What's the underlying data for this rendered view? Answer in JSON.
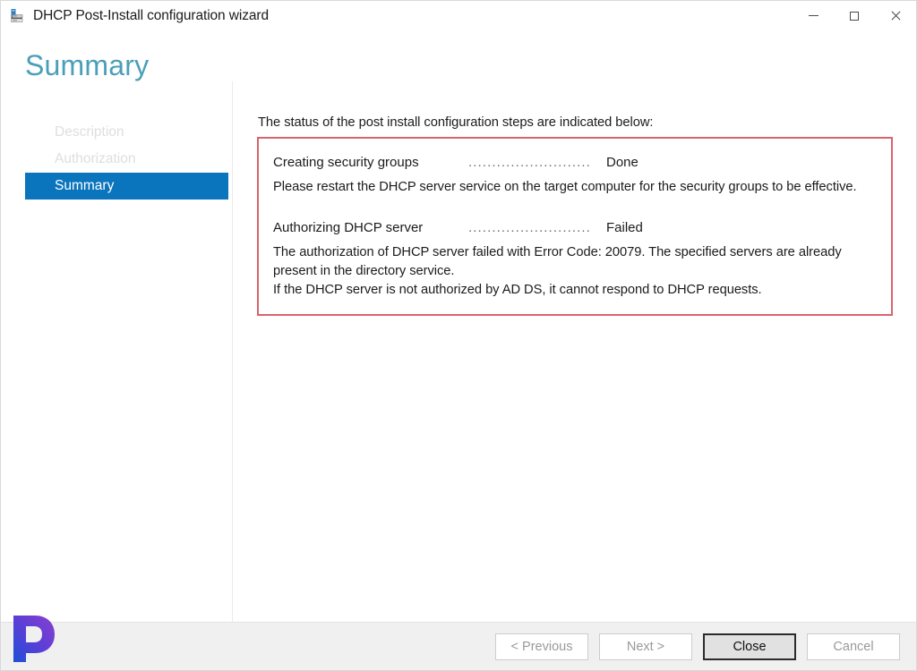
{
  "window": {
    "title": "DHCP Post-Install configuration wizard",
    "icon": "dhcp-server-icon",
    "controls": {
      "minimize": "minimize-icon",
      "maximize": "maximize-icon",
      "close": "close-icon"
    }
  },
  "page": {
    "heading": "Summary",
    "heading_color": "#4a9fb8"
  },
  "sidebar": {
    "items": [
      {
        "label": "Description",
        "state": "disabled"
      },
      {
        "label": "Authorization",
        "state": "disabled"
      },
      {
        "label": "Summary",
        "state": "selected"
      }
    ],
    "selected_color": "#0a74bd"
  },
  "main": {
    "intro": "The status of the post install configuration steps are indicated below:",
    "panel": {
      "border_color": "#d9636d",
      "rows": [
        {
          "label": "Creating security groups",
          "leader": "......................................",
          "value": "Done",
          "note": "Please restart the DHCP server service on the target computer for the security groups to be effective."
        },
        {
          "label": "Authorizing DHCP server",
          "leader": "......................................",
          "value": "Failed",
          "error_line_1": "The authorization of DHCP server failed with Error Code: 20079. The specified servers are already present in the directory service.",
          "error_line_2": "If the DHCP server is not authorized by AD DS, it cannot respond to DHCP requests."
        }
      ]
    }
  },
  "footer": {
    "buttons": [
      {
        "label": "< Previous",
        "state": "disabled"
      },
      {
        "label": "Next >",
        "state": "disabled"
      },
      {
        "label": "Close",
        "state": "enabled"
      },
      {
        "label": "Cancel",
        "state": "disabled"
      }
    ]
  },
  "watermark": {
    "name": "prajwal-p-logo",
    "letter": "P"
  }
}
